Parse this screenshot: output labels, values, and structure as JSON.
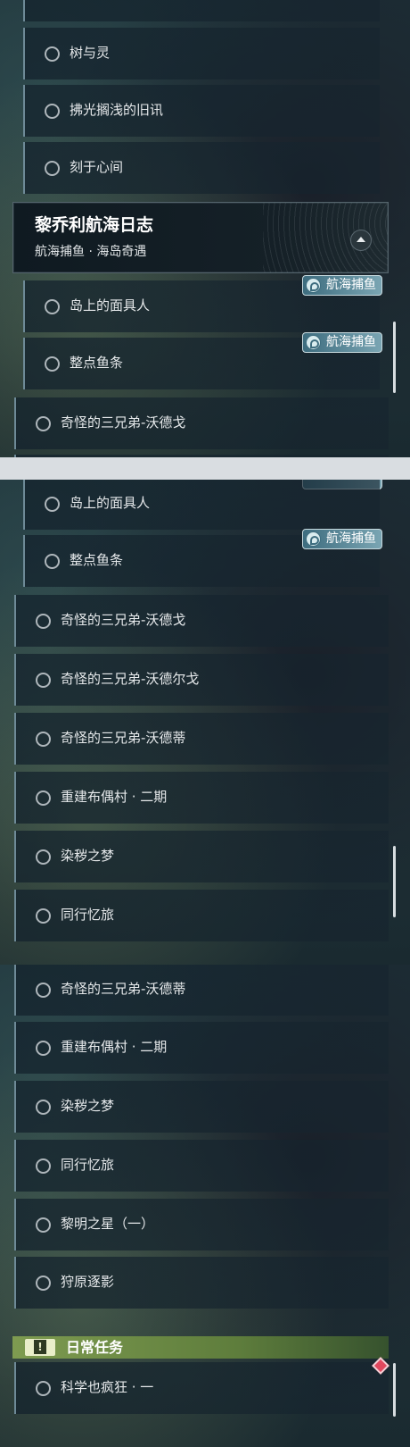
{
  "panel1": {
    "items": [
      {
        "label": "树与灵"
      },
      {
        "label": "拂光搁浅的旧讯"
      },
      {
        "label": "刻于心间"
      }
    ],
    "group_header": {
      "title": "黎乔利航海日志",
      "subtitle": "航海捕鱼 · 海岛奇遇"
    },
    "group_items": [
      {
        "label": "岛上的面具人",
        "tag": "航海捕鱼"
      },
      {
        "label": "整点鱼条",
        "tag": "航海捕鱼"
      }
    ],
    "main_items": [
      {
        "label": "奇怪的三兄弟-沃德戈"
      }
    ]
  },
  "panel2": {
    "group_items": [
      {
        "label": "岛上的面具人"
      },
      {
        "label": "整点鱼条",
        "tag": "航海捕鱼"
      }
    ],
    "main_items": [
      {
        "label": "奇怪的三兄弟-沃德戈"
      },
      {
        "label": "奇怪的三兄弟-沃德尔戈"
      },
      {
        "label": "奇怪的三兄弟-沃德蒂"
      },
      {
        "label": "重建布偶村 · 二期"
      },
      {
        "label": "染秽之梦"
      },
      {
        "label": "同行忆旅"
      }
    ]
  },
  "panel3": {
    "main_items": [
      {
        "label": "奇怪的三兄弟-沃德蒂"
      },
      {
        "label": "重建布偶村 · 二期"
      },
      {
        "label": "染秽之梦"
      },
      {
        "label": "同行忆旅"
      },
      {
        "label": "黎明之星（一）"
      },
      {
        "label": "狩原逐影"
      }
    ],
    "daily_section": {
      "title": "日常任务"
    },
    "daily_items": [
      {
        "label": "科学也疯狂 · 一"
      }
    ]
  },
  "icons": {
    "radio": "circle-outline-icon",
    "collapse": "chevron-up-icon",
    "tag": "fishing-hook-icon",
    "daily": "exclamation-icon",
    "marker": "red-diamond-icon"
  },
  "colors": {
    "tag_bg": "#5f8fa0",
    "daily_bg": "#7e9b50",
    "marker": "#e0485e"
  }
}
